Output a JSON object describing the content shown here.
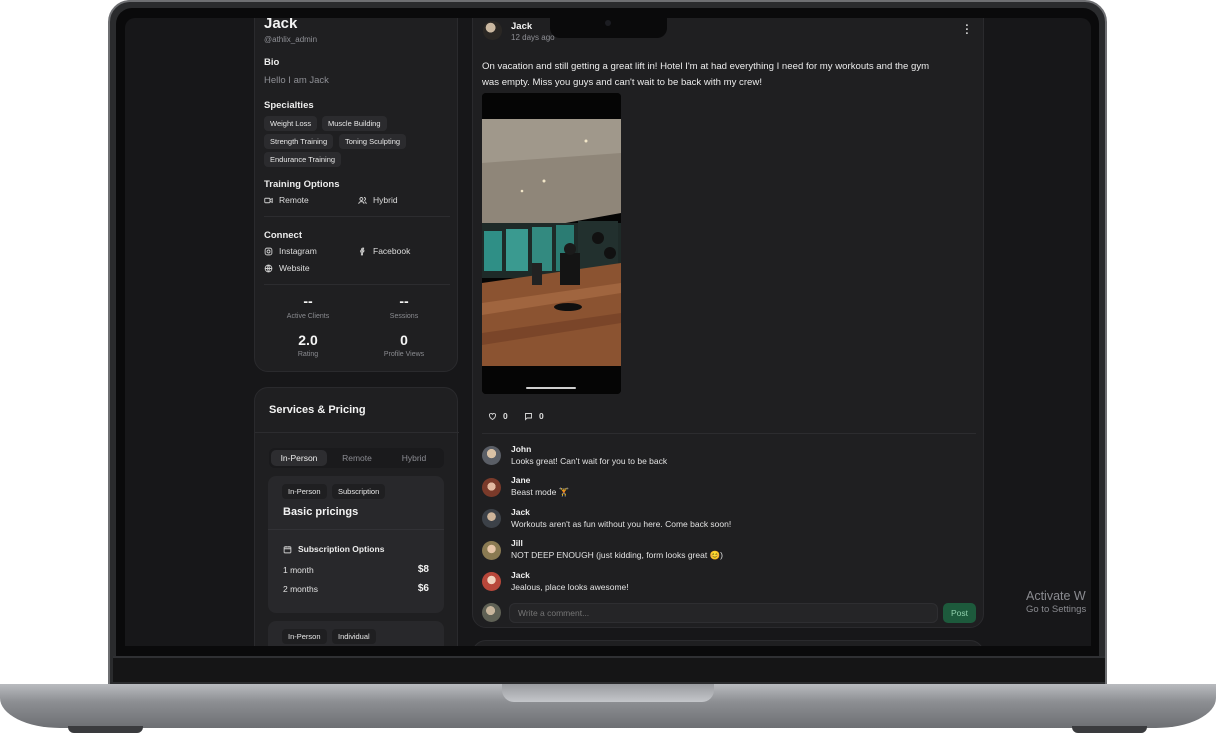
{
  "profile": {
    "name": "Jack",
    "handle": "@athlix_admin",
    "bio_heading": "Bio",
    "bio_text": "Hello I am Jack",
    "specialties_heading": "Specialties",
    "specialties": [
      "Weight Loss",
      "Muscle Building",
      "Strength Training",
      "Toning Sculpting",
      "Endurance Training"
    ],
    "training_heading": "Training Options",
    "training_options": [
      {
        "label": "Remote",
        "icon": "video-icon"
      },
      {
        "label": "Hybrid",
        "icon": "users-icon"
      }
    ],
    "connect_heading": "Connect",
    "connect_links": [
      {
        "label": "Instagram",
        "icon": "instagram-icon"
      },
      {
        "label": "Facebook",
        "icon": "facebook-icon"
      },
      {
        "label": "Website",
        "icon": "globe-icon"
      }
    ],
    "stats": [
      {
        "value": "--",
        "label": "Active Clients"
      },
      {
        "value": "--",
        "label": "Sessions"
      },
      {
        "value": "2.0",
        "label": "Rating"
      },
      {
        "value": "0",
        "label": "Profile Views"
      }
    ]
  },
  "services": {
    "title": "Services & Pricing",
    "tabs": [
      "In-Person",
      "Remote",
      "Hybrid"
    ],
    "active_tab": "In-Person",
    "plan": {
      "tags": [
        "In-Person",
        "Subscription"
      ],
      "title": "Basic pricings",
      "options_heading": "Subscription Options",
      "options": [
        {
          "label": "1 month",
          "price": "$8"
        },
        {
          "label": "2 months",
          "price": "$6"
        }
      ]
    },
    "next_plan_tags": [
      "In-Person",
      "Individual"
    ]
  },
  "post": {
    "author": "Jack",
    "time": "12 days ago",
    "text_line1": "On vacation and still getting a great lift in! Hotel I'm at had everything I need for my workouts and the gym",
    "text_line2": "was empty. Miss you guys and can't wait to be back with my crew!",
    "likes": "0",
    "comments_count": "0",
    "comments": [
      {
        "name": "John",
        "text": "Looks great! Can't wait for you to be back"
      },
      {
        "name": "Jane",
        "text": "Beast mode 🏋"
      },
      {
        "name": "Jack",
        "text": "Workouts aren't as fun without you here. Come back soon!"
      },
      {
        "name": "Jill",
        "text": "NOT DEEP ENOUGH (just kidding, form looks great 😊)"
      },
      {
        "name": "Jack",
        "text": "Jealous, place looks awesome!"
      }
    ],
    "comment_placeholder": "Write a comment...",
    "post_button": "Post"
  },
  "watermark": {
    "line1": "Activate W",
    "line2": "Go to Settings"
  },
  "colors": {
    "background": "#171719",
    "card": "#1f1f21",
    "post_button": "#1d5a3c"
  }
}
